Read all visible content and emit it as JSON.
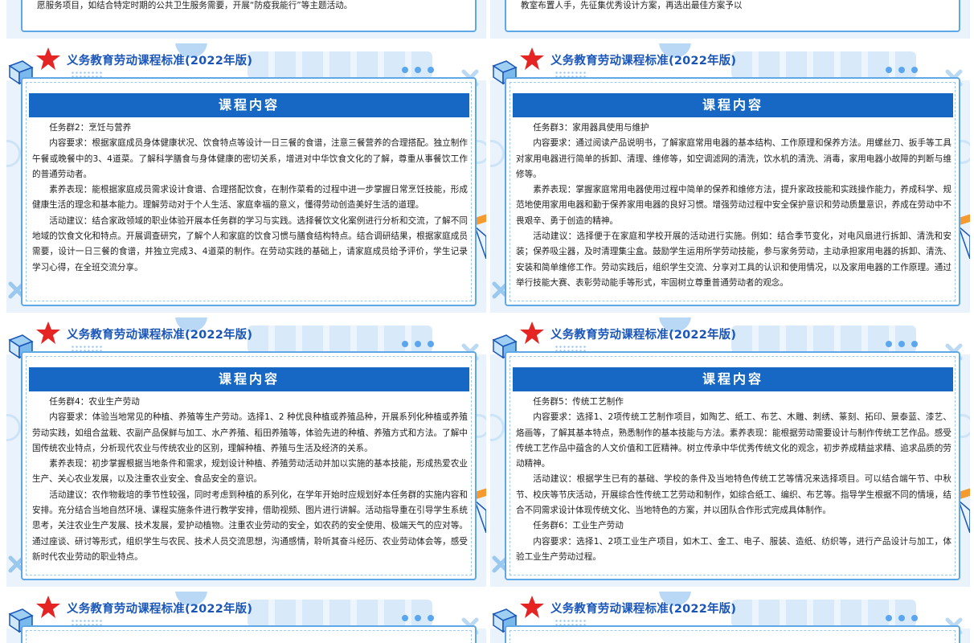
{
  "top_snippets": {
    "left": "愿服务项目，如结合特定时期的公共卫生服务需要，开展“防疫我能行”等主题活动。",
    "right": "教室布置人手，先征集优秀设计方案，再选出最佳方案予以"
  },
  "slides": [
    {
      "title": "义务教育劳动课程标准(2022年版)",
      "band": "课程内容",
      "paragraphs": [
        "任务群2：烹饪与营养",
        "内容要求：根据家庭成员身体健康状况、饮食特点等设计一日三餐的食谱，注意三餐营养的合理搭配。独立制作午餐或晚餐中的3、4道菜。了解科学膳食与身体健康的密切关系，增进对中华饮食文化的了解，尊重从事餐饮工作的普通劳动者。",
        "素养表现：能根据家庭成员需求设计食谱、合理搭配饮食，在制作菜肴的过程中进一步掌握日常烹饪技能，形成健康生活的理念和基本能力。理解劳动对于个人生活、家庭幸福的意义，懂得劳动创造美好生活的道理。",
        "活动建议：结合家政领域的职业体验开展本任务群的学习与实践。选择餐饮文化案例进行分析和交流，了解不同地域的饮食文化和特点。开展调查研究，了解个人和家庭的饮食习惯与膳食结构特点。结合调研结果，根据家庭成员需要，设计一日三餐的食谱，并独立完成3、4道菜的制作。在劳动实践的基础上，请家庭成员给予评价，学生记录学习心得，在全班交流分享。"
      ]
    },
    {
      "title": "义务教育劳动课程标准(2022年版)",
      "band": "课程内容",
      "paragraphs": [
        "任务群3：家用器具使用与维护",
        "内容要求：通过阅读产品说明书，了解家庭常用电器的基本结构、工作原理和保养方法。用螺丝刀、扳手等工具对家用电器进行简单的拆卸、清理、维修等，如空调滤网的清洗，饮水机的清洗、消毒，家用电器小故障的判断与维修等。",
        "素养表现：掌握家庭常用电器使用过程中简单的保养和维修方法，提升家政技能和实践操作能力，养成科学、规范地使用家用电器和勤于保养家用电器的良好习惯。增强劳动过程中安全保护意识和劳动质量意识，养成在劳动中不畏艰辛、勇于创造的精神。",
        "活动建议：选择便于在家庭和学校开展的活动进行实施。例如：结合季节变化，对电风扇进行拆卸、清洗和安装；保养吸尘器，及时清理集尘盒。鼓励学生运用所学劳动技能，参与家务劳动，主动承担家用电器的拆卸、清洗、安装和简单维修工作。劳动实践后，组织学生交流、分享对工具的认识和使用情况，以及家用电器的工作原理。通过举行技能大赛、表彰劳动能手等形式，牢固树立尊重普通劳动者的观念。"
      ]
    },
    {
      "title": "义务教育劳动课程标准(2022年版)",
      "band": "课程内容",
      "paragraphs": [
        "任务群4：农业生产劳动",
        "内容要求：体验当地常见的种植、养殖等生产劳动。选择1、2 种优良种植或养殖品种，开展系列化种植或养殖劳动实践，如组合盆栽、农副产品保鲜与加工、水产养殖、稻田养殖等，体验先进的种植、养殖方式和方法。了解中国传统农业特点，分析现代农业与传统农业的区别，理解种植、养殖与生活及经济的关系。",
        "素养表现：初步掌握根据当地条件和需求，规划设计种植、养殖劳动活动并加以实施的基本技能，形成热爱农业生产、关心农业发展，以及注重农业安全、食品安全的意识。",
        "活动建议：农作物栽培的季节性较强，同时考虑到种植的系列化，在学年开始时应规划好本任务群的实施内容和安排。充分结合当地自然环境、课程实施条件进行教学安排，借助视频、图片进行讲解。活动指导重在引导学生系统思考，关注农业生产发展、技术发展，爱护动植物。注重农业劳动的安全，如农药的安全使用、极端天气的应对等。通过座谈、研讨等形式，组织学生与农民、技术人员交流思想，沟通感情，聆听其奋斗经历、农业劳动体会等，感受新时代农业劳动的职业特点。"
      ]
    },
    {
      "title": "义务教育劳动课程标准(2022年版)",
      "band": "课程内容",
      "paragraphs": [
        "任务群5：传统工艺制作",
        "内容要求：选择1、2项传统工艺制作项目，如陶艺、纸工、布艺、木雕、刺绣、篆刻、拓印、景泰蓝、漆艺、烙画等，了解其基本特点，熟悉制作的基本技能与方法。素养表现：能根据劳动需要设计与制作传统工艺作品。感受传统工艺作品中蕴含的人文价值和工匠精神。树立传承中华优秀传统文化的观念，初步养成精益求精、追求品质的劳动精神。",
        "活动建议：根据学生已有的基础、学校的条件及当地特色传统工艺等情况来选择项目。可以结合端午节、中秋节、校庆等节庆活动，开展综合性传统工艺劳动和制作，如综合纸工、编织、布艺等。指导学生根据不同的情境，结合不同需求设计体现传统文化、当地特色的方案，并以团队合作形式完成具体制作。",
        "任务群6：工业生产劳动",
        "内容要求：选择1、2项工业生产项目，如木工、金工、电子、服装、造纸、纺织等，进行产品设计与加工，体验工业生产劳动过程。"
      ]
    },
    {
      "title": "义务教育劳动课程标准(2022年版)"
    },
    {
      "title": "义务教育劳动课程标准(2022年版)"
    }
  ]
}
